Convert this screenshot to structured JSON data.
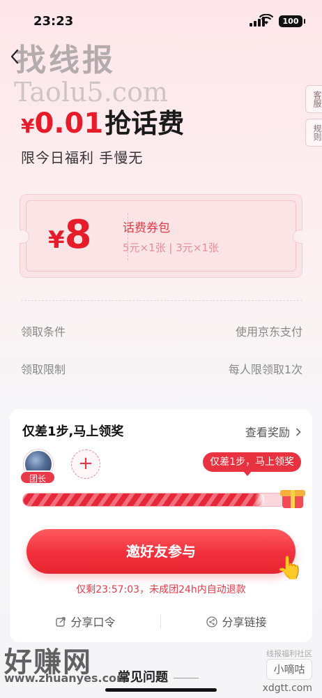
{
  "status_bar": {
    "time": "23:23",
    "battery": "100"
  },
  "watermarks": {
    "top": "找线报",
    "top_latin": "Taolu5.com",
    "bottom": "好赚网",
    "bottom_url": "www.zhuanyes.com",
    "right_badge": "小嘀咕",
    "right_url": "xdgtt.com",
    "right_caption": "线报福利社区"
  },
  "side_tabs": [
    "客服",
    "规则"
  ],
  "hero": {
    "amount_symbol": "¥",
    "amount": "0.01",
    "title": "抢话费",
    "subtitle": "限今日福利 手慢无"
  },
  "coupon": {
    "symbol": "¥",
    "value": "8",
    "name": "话费券包",
    "detail": "5元×1张 | 3元×1张"
  },
  "conditions": [
    {
      "label": "领取条件",
      "value": "使用京东支付"
    },
    {
      "label": "领取限制",
      "value": "每人限领取1次"
    }
  ],
  "group": {
    "title": "仅差1步,马上领奖",
    "view_rewards": "查看奖励",
    "leader_badge": "团长",
    "invite_plus": "+",
    "bubble": "仅差1步，马上领奖",
    "progress": 0.92,
    "cta": "邀好友参与",
    "countdown": "仅剩23:57:03，未成团24h内自动退款",
    "share_code": "分享口令",
    "share_link": "分享链接"
  },
  "faq": "常见问题",
  "colors": {
    "accent": "#e61c2b",
    "cta": "#f0303c"
  }
}
